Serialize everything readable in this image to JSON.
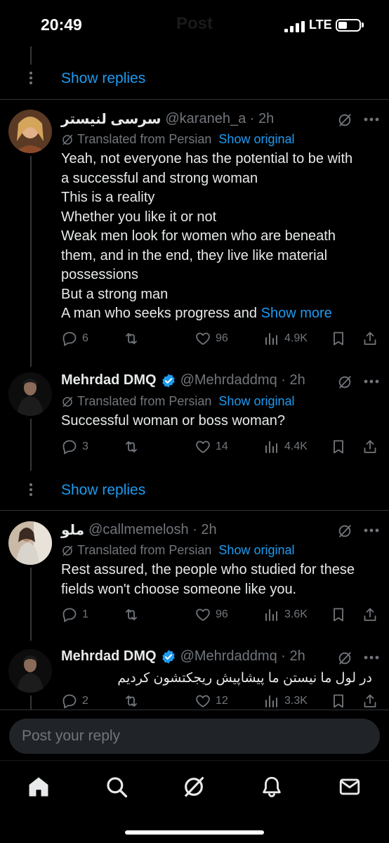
{
  "status": {
    "time": "20:49",
    "network": "LTE",
    "header_title": "Post"
  },
  "thread_top": {
    "show_replies": "Show replies"
  },
  "tweets": [
    {
      "name": "سرسی لنیستر",
      "handle": "@karaneh_a · 2h",
      "translated_label": "Translated from Persian",
      "show_original": "Show original",
      "text_lines": [
        "Yeah, not everyone has the potential to be with",
        "a successful and strong woman",
        "This is a reality",
        "Whether you like it or not",
        "Weak men look for women who are beneath",
        "them, and in the end, they live like material",
        "possessions",
        "But a strong man",
        "A man who seeks progress and"
      ],
      "show_more": "Show more",
      "replies": "6",
      "reposts": "",
      "likes": "96",
      "views": "4.9K"
    },
    {
      "name": "Mehrdad DMQ",
      "handle": "@Mehrdaddmq · 2h",
      "translated_label": "Translated from Persian",
      "show_original": "Show original",
      "text": "Successful woman or boss woman?",
      "replies": "3",
      "reposts": "",
      "likes": "14",
      "views": "4.4K"
    },
    {
      "name": "ملو",
      "handle": "@callmemelosh · 2h",
      "translated_label": "Translated from Persian",
      "show_original": "Show original",
      "text_lines": [
        "Rest assured, the people who studied for these",
        "fields won't choose someone like you."
      ],
      "replies": "1",
      "reposts": "",
      "likes": "96",
      "views": "3.6K"
    },
    {
      "name": "Mehrdad DMQ",
      "handle": "@Mehrdaddmq · 2h",
      "text": "در لول ما نیستن ما پیشاپیش ریجکتشون کردیم",
      "replies": "2",
      "reposts": "",
      "likes": "12",
      "views": "3.3K"
    }
  ],
  "mid_thread": {
    "show_replies": "Show replies"
  },
  "reply": {
    "placeholder": "Post your reply"
  },
  "tabbar": {
    "items": [
      "home-icon",
      "search-icon",
      "grok-icon",
      "notifications-icon",
      "messages-icon"
    ]
  },
  "colors": {
    "background": "#000000",
    "accent": "#1d9bf0",
    "muted": "#71767b",
    "text": "#e7e9ea"
  }
}
